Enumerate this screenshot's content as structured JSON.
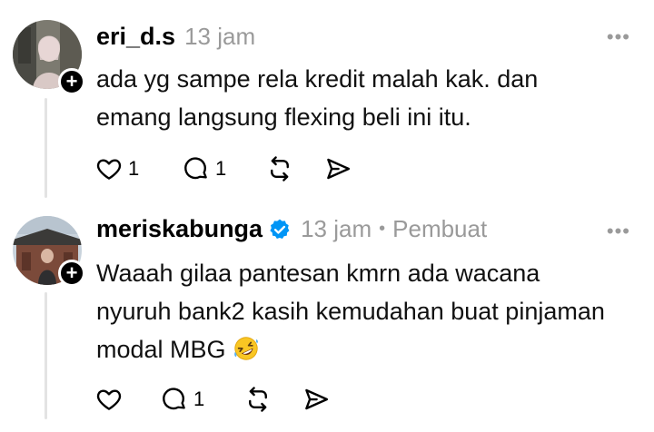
{
  "posts": [
    {
      "username": "eri_d.s",
      "timestamp": "13 jam",
      "verified": false,
      "author_tag": "",
      "more_label": "•••",
      "text_lines": [
        "ada yg sampe rela kredit malah kak. dan",
        "emang langsung flexing beli ini itu."
      ],
      "likes": "1",
      "replies": "1"
    },
    {
      "username": "meriskabunga",
      "timestamp": "13 jam",
      "verified": true,
      "separator": "•",
      "author_tag": "Pembuat",
      "more_label": "•••",
      "text_lines": [
        "Waaah gilaa pantesan kmrn ada wacana",
        "nyuruh bank2 kasih kemudahan buat pinjaman",
        "modal MBG"
      ],
      "emoji": "rolling-on-the-floor-laughing",
      "likes": "",
      "replies": "1"
    }
  ],
  "follow_symbol": "+",
  "icons": [
    "heart-icon",
    "reply-icon",
    "repost-icon",
    "share-icon",
    "verified-icon"
  ],
  "colors": {
    "verified_blue": "#0095f6",
    "muted_gray": "#9a9a9a"
  }
}
